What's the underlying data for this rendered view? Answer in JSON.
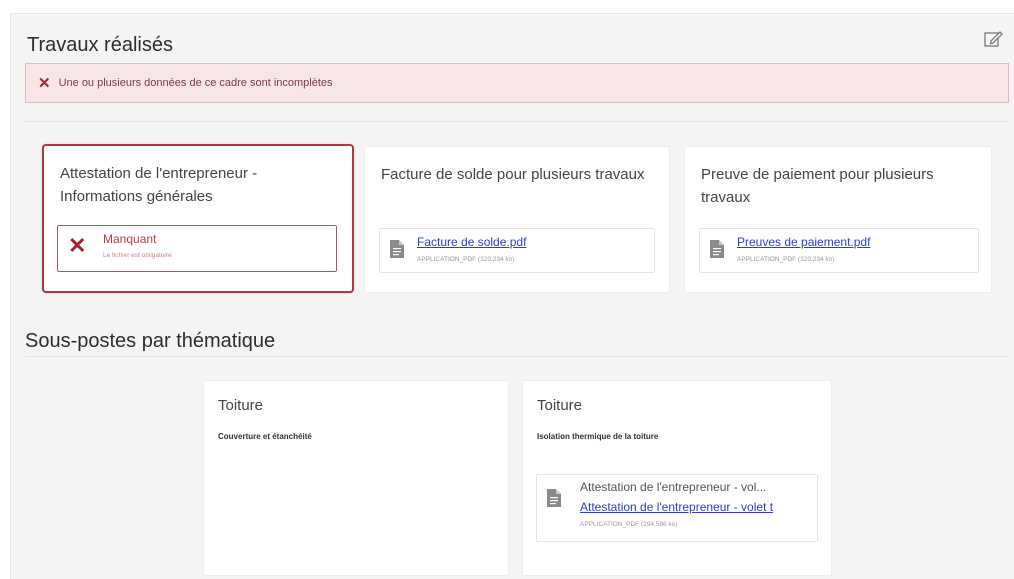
{
  "section": {
    "title": "Travaux réalisés",
    "edit_icon": "edit-icon",
    "alert": {
      "icon": "error-x-icon",
      "text": "Une ou plusieurs données de ce cadre sont incomplètes"
    }
  },
  "cards": [
    {
      "title": "Attestation de l'entrepreneur - Informations générales",
      "status": "error",
      "missing_label": "Manquant",
      "missing_sub": "Le fichier est obligatoire"
    },
    {
      "title": "Facture de solde pour plusieurs travaux",
      "file_link": "Facture de solde.pdf",
      "file_meta": "APPLICATION_PDF (320.234 ko)"
    },
    {
      "title": "Preuve de paiement pour plusieurs travaux",
      "file_link": "Preuves de paiement.pdf",
      "file_meta": "APPLICATION_PDF (320.234 ko)"
    }
  ],
  "subsection": {
    "title": "Sous-postes par thématique",
    "cards": [
      {
        "title": "Toiture",
        "sub": "Couverture et étanchéité"
      },
      {
        "title": "Toiture",
        "sub": "Isolation thermique de la toiture",
        "doc_name": "Attestation de l'entrepreneur - vol...",
        "doc_link": "Attestation de l'entrepreneur - volet t",
        "doc_meta": "APPLICATION_PDF (294.586 ko)"
      }
    ]
  },
  "colors": {
    "error": "#a2242f",
    "link": "#2f3fc8",
    "alert_bg": "#f7e6e8"
  }
}
